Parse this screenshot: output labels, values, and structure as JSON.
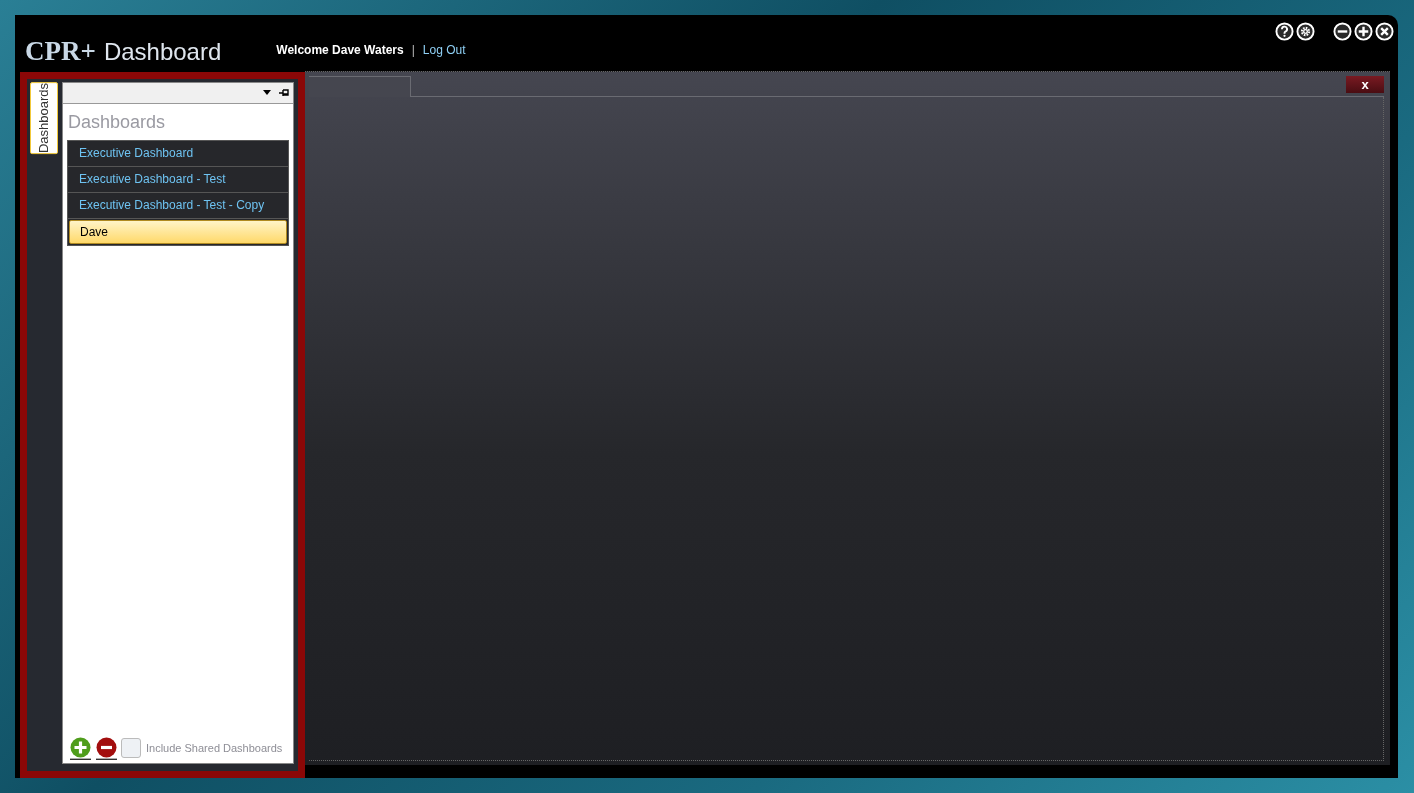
{
  "header": {
    "logo": "CPR+",
    "app_name": "Dashboard",
    "welcome": "Welcome Dave Waters",
    "separator": "|",
    "logout": "Log Out"
  },
  "side_tabs": [
    {
      "label": "Dashboards",
      "selected": true
    }
  ],
  "panel": {
    "heading": "Dashboards",
    "items": [
      {
        "label": "Executive Dashboard",
        "selected": false
      },
      {
        "label": "Executive Dashboard - Test",
        "selected": false
      },
      {
        "label": "Executive Dashboard - Test - Copy",
        "selected": false
      },
      {
        "label": "Dave",
        "selected": true
      }
    ],
    "include_shared": {
      "label": "Include Shared Dashboards",
      "checked": false
    }
  },
  "content": {
    "close_label": "x"
  }
}
